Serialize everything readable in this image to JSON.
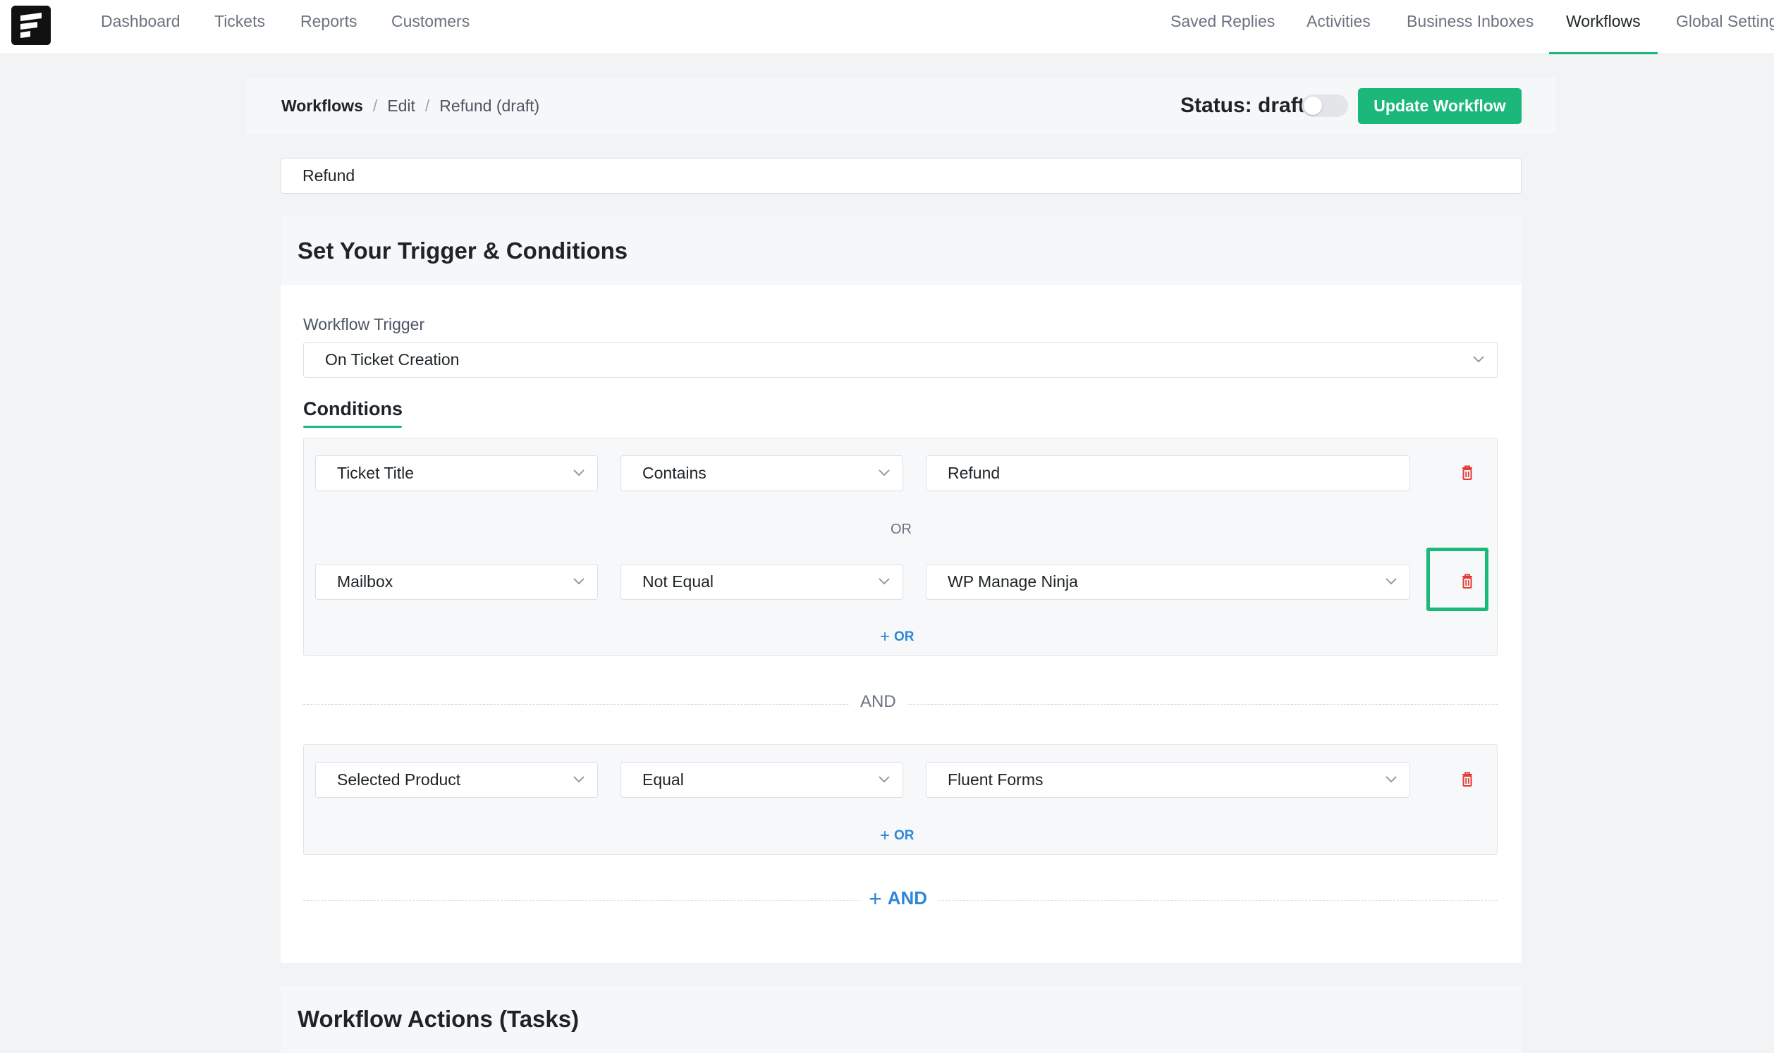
{
  "nav": {
    "left": [
      "Dashboard",
      "Tickets",
      "Reports",
      "Customers"
    ],
    "right": [
      "Saved Replies",
      "Activities",
      "Business Inboxes",
      "Workflows",
      "Global Settings"
    ],
    "active": "Workflows"
  },
  "breadcrumb": {
    "root": "Workflows",
    "edit": "Edit",
    "current": "Refund (draft)"
  },
  "status": {
    "label": "Status: draft",
    "enabled": false
  },
  "update_button": "Update Workflow",
  "workflow_title": "Refund",
  "trigger_section": {
    "heading": "Set Your Trigger & Conditions",
    "trigger_label": "Workflow Trigger",
    "trigger_value": "On Ticket Creation",
    "conditions_heading": "Conditions"
  },
  "condition_groups": [
    {
      "rows": [
        {
          "field": "Ticket Title",
          "operator": "Contains",
          "value": "Refund"
        },
        {
          "field": "Mailbox",
          "operator": "Not Equal",
          "value": "WP Manage Ninja"
        }
      ],
      "or_separator": "OR",
      "add_or": "OR"
    },
    {
      "rows": [
        {
          "field": "Selected Product",
          "operator": "Equal",
          "value": "Fluent Forms"
        }
      ],
      "add_or": "OR"
    }
  ],
  "and_separator": "AND",
  "add_and": "AND",
  "actions_section": {
    "heading": "Workflow Actions (Tasks)"
  },
  "colors": {
    "accent": "#1bb87a",
    "link": "#2f86d9",
    "danger": "#e53935"
  }
}
